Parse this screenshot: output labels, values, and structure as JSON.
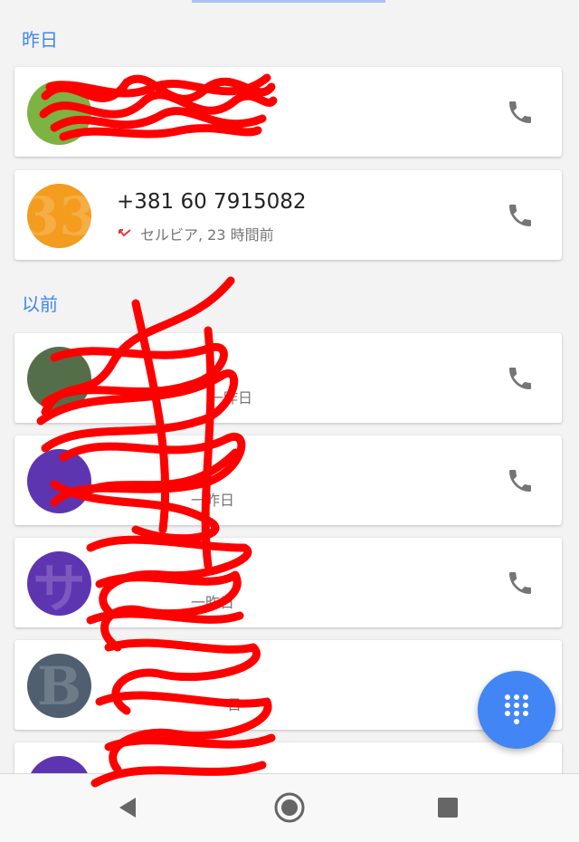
{
  "colors": {
    "accent": "#4285f4",
    "missed_call": "#e53935",
    "outgoing_call": "#34a853",
    "redaction": "#ff0000"
  },
  "sections": [
    {
      "header": "昨日"
    },
    {
      "header": "以前"
    }
  ],
  "calls": [
    {
      "name": "",
      "detail": "",
      "call_type": "outgoing",
      "call_icon": "phone-icon",
      "avatar_color": "#7cb342",
      "redacted": true
    },
    {
      "name": "+381 60 7915082",
      "detail": "セルビア, 23 時間前",
      "call_type": "missed",
      "call_icon": "phone-icon",
      "avatar_color": "#f39c1d",
      "avatar_letter": "33"
    },
    {
      "name": "",
      "detail": "一昨日",
      "call_type": "",
      "call_icon": "phone-icon",
      "avatar_color": "#546e4a",
      "redacted": true
    },
    {
      "name": "",
      "detail": "一昨日",
      "call_type": "",
      "call_icon": "phone-icon",
      "avatar_color": "#5e35b1",
      "redacted": true
    },
    {
      "name": "",
      "detail": "一昨日",
      "call_type": "",
      "call_icon": "phone-icon",
      "avatar_color": "#5e35b1",
      "avatar_letter": "サ",
      "redacted": true
    },
    {
      "name": "",
      "detail": "日",
      "call_type": "",
      "call_icon": "phone-icon",
      "avatar_color": "#4f5f6f",
      "avatar_letter": "B",
      "redacted": true
    },
    {
      "name": "",
      "detail": "",
      "call_type": "",
      "call_icon": "phone-icon",
      "avatar_color": "#5e35b1",
      "redacted": true
    }
  ],
  "fab": {
    "icon": "dialpad-icon"
  },
  "nav": {
    "back_icon": "back-icon",
    "home_icon": "home-icon",
    "recents_icon": "recents-icon"
  }
}
